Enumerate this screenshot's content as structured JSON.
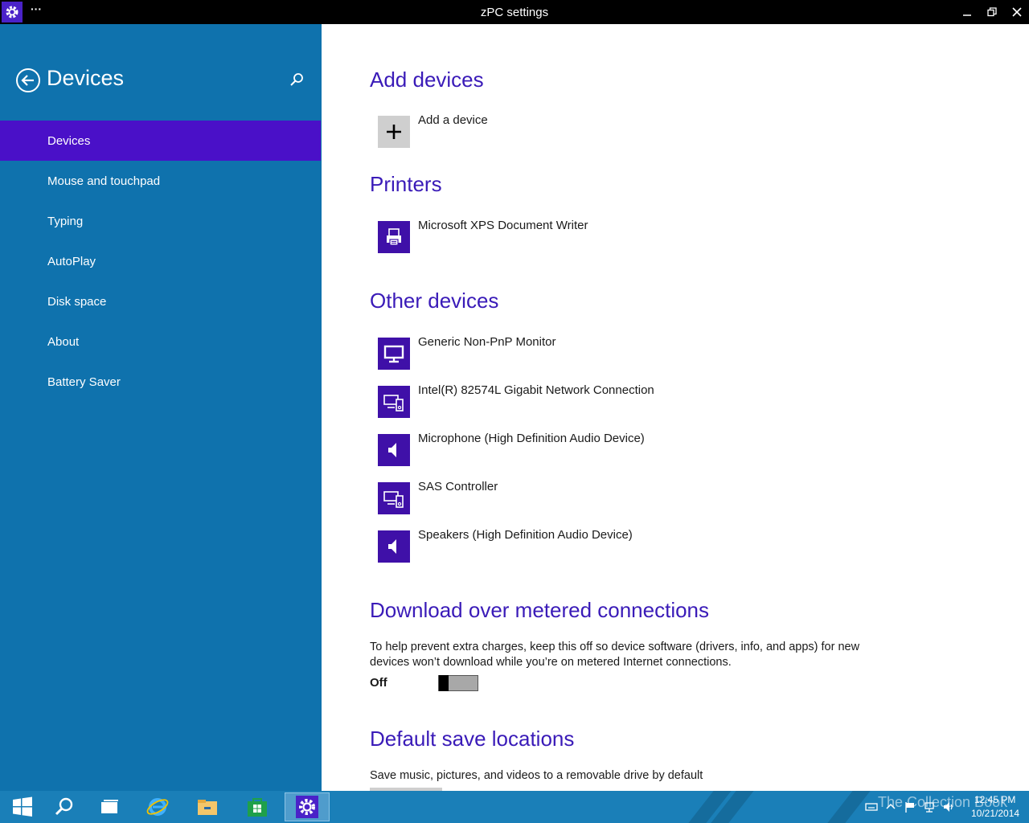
{
  "window": {
    "title": "zPC settings",
    "more_label": "···"
  },
  "sidebar": {
    "title": "Devices",
    "items": [
      {
        "label": "Devices",
        "active": true
      },
      {
        "label": "Mouse and touchpad"
      },
      {
        "label": "Typing"
      },
      {
        "label": "AutoPlay"
      },
      {
        "label": "Disk space"
      },
      {
        "label": "About"
      },
      {
        "label": "Battery Saver"
      }
    ]
  },
  "main": {
    "add_devices": {
      "title": "Add devices",
      "add_label": "Add a device"
    },
    "printers": {
      "title": "Printers",
      "items": [
        {
          "label": "Microsoft XPS Document Writer",
          "icon": "printer-icon"
        }
      ]
    },
    "other_devices": {
      "title": "Other devices",
      "items": [
        {
          "label": "Generic Non-PnP Monitor",
          "icon": "monitor-icon"
        },
        {
          "label": "Intel(R) 82574L Gigabit Network Connection",
          "icon": "devices-icon"
        },
        {
          "label": "Microphone (High Definition Audio Device)",
          "icon": "speaker-icon"
        },
        {
          "label": "SAS Controller",
          "icon": "devices-icon"
        },
        {
          "label": "Speakers (High Definition Audio Device)",
          "icon": "speaker-icon"
        }
      ]
    },
    "metered": {
      "title": "Download over metered connections",
      "description": "To help prevent extra charges, keep this off so device software (drivers, info, and apps) for new devices won’t download while you’re on metered Internet connections.",
      "toggle_label": "Off",
      "toggle_on": false
    },
    "save_locations": {
      "title": "Default save locations",
      "description": "Save music, pictures, and videos to a removable drive by default"
    }
  },
  "taskbar": {
    "watermark": "The Collection Book",
    "time": "12:45 PM",
    "date": "10/21/2014"
  },
  "colors": {
    "sidebar_bg": "#0f72ad",
    "nav_active_bg": "#4a10c8",
    "accent_title": "#3a1bb8",
    "tile_bg": "#3f10a8",
    "taskbar_bg": "#1a7fb8"
  }
}
